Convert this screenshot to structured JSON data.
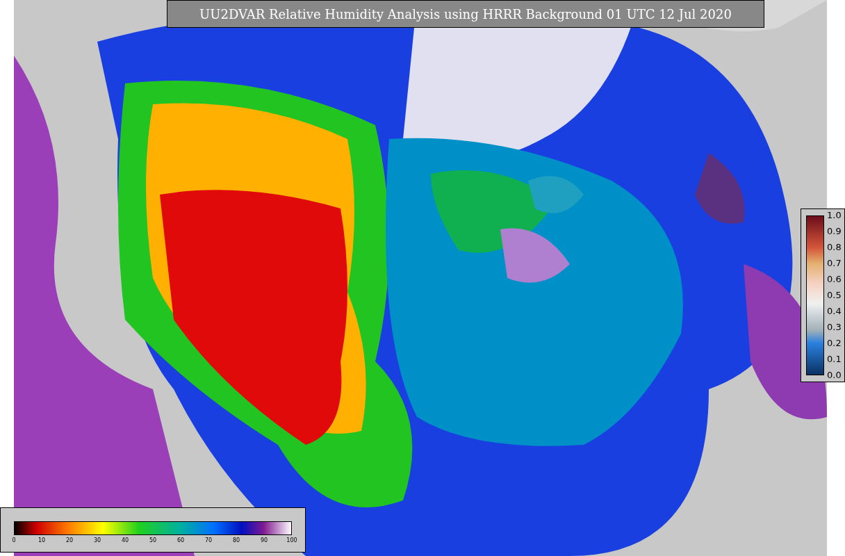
{
  "title": "UU2DVAR Relative Humidity Analysis using HRRR Background 01 UTC 12 Jul 2020",
  "right_colorbar": {
    "ticks": [
      "1.0",
      "0.9",
      "0.8",
      "0.7",
      "0.6",
      "0.5",
      "0.4",
      "0.3",
      "0.2",
      "0.1",
      "0.0"
    ]
  },
  "bottom_colorbar": {
    "ticks": [
      "0",
      "10",
      "20",
      "30",
      "40",
      "50",
      "60",
      "70",
      "80",
      "90",
      "100"
    ]
  }
}
